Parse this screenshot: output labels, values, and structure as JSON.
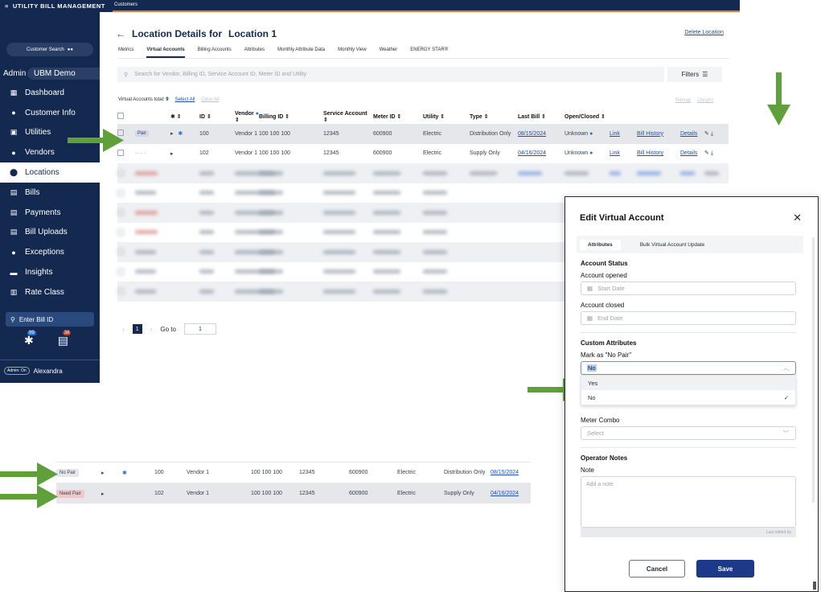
{
  "app": {
    "brand": "UTILITY BILL MANAGEMENT",
    "crumb": "Customers"
  },
  "sidebar": {
    "customer_search": "Customer Search",
    "role": "Admin",
    "org": "UBM Demo",
    "items": [
      {
        "label": "Dashboard",
        "icon": "dashboard-icon"
      },
      {
        "label": "Customer Info",
        "icon": "person-icon"
      },
      {
        "label": "Utilities",
        "icon": "utilities-icon"
      },
      {
        "label": "Vendors",
        "icon": "person-icon"
      },
      {
        "label": "Locations",
        "icon": "location-pin-icon"
      },
      {
        "label": "Bills",
        "icon": "bills-icon"
      },
      {
        "label": "Payments",
        "icon": "payments-icon"
      },
      {
        "label": "Bill Uploads",
        "icon": "upload-icon"
      },
      {
        "label": "Exceptions",
        "icon": "exclamation-icon"
      },
      {
        "label": "Insights",
        "icon": "insights-icon"
      },
      {
        "label": "Rate Class",
        "icon": "chart-icon"
      }
    ],
    "bill_id_placeholder": "Enter Bill ID",
    "badge_a": "99",
    "badge_b": "38",
    "admin_on": "Admin: On",
    "user": "Alexandra"
  },
  "page": {
    "title_prefix": "Location Details for",
    "title_location": "Location 1",
    "delete": "Delete Location",
    "tabs": [
      "Metrics",
      "Virtual Accounts",
      "Billing Accounts",
      "Attributes",
      "Monthly Attribute Data",
      "Monthly View",
      "Weather",
      "ENERGY STAR®"
    ],
    "search_placeholder": "Search for Vendor, Billing ID, Service Account ID, Meter ID and Utility",
    "filters": "Filters",
    "totals_label": "Virtual Accounts total:",
    "totals_value": "9",
    "select_all": "Select All",
    "clear_all": "Clear All",
    "remap": "Remap",
    "unsync": "Unsync",
    "goto": "Go to",
    "goto_value": "1",
    "page_current": "1"
  },
  "table": {
    "headers": [
      "",
      "",
      "✱ ⇕",
      "ID ⇕",
      "Vendor",
      "Billing ID ⇕",
      "Service Account ⇕",
      "Meter ID ⇕",
      "Utility ⇕",
      "Type ⇕",
      "Last Bill ⇕",
      "Open/Closed ⇕"
    ],
    "rows": [
      {
        "tag": "Pair",
        "star": "✱",
        "id": "100",
        "vendor": "Vendor 1",
        "billing": "100 100 100",
        "service": "12345",
        "meter": "600900",
        "utility": "Electric",
        "type": "Distribution Only",
        "last_bill": "08/15/2024",
        "status": "Unknown",
        "link": "Link",
        "history": "Bill History",
        "details": "Details"
      },
      {
        "tag": "",
        "star": "",
        "id": "102",
        "vendor": "Vendor 1",
        "billing": "100 100 100",
        "service": "12345",
        "meter": "600900",
        "utility": "Electric",
        "type": "Supply Only",
        "last_bill": "04/16/2024",
        "status": "Unknown",
        "link": "Link",
        "history": "Bill History",
        "details": "Details"
      }
    ]
  },
  "strip": {
    "rows": [
      {
        "tag": "No Pair",
        "star": "✱",
        "id": "100",
        "vendor": "Vendor 1",
        "billing": "100 100 100",
        "service": "12345",
        "meter": "600900",
        "utility": "Electric",
        "type": "Distribution Only",
        "last_bill": "08/15/2024"
      },
      {
        "tag": "Need Pair",
        "star": "",
        "id": "102",
        "vendor": "Vendor 1",
        "billing": "100 100 100",
        "service": "12345",
        "meter": "600900",
        "utility": "Electric",
        "type": "Supply Only",
        "last_bill": "04/16/2024"
      }
    ]
  },
  "modal": {
    "title": "Edit Virtual Account",
    "tabs": [
      "Attributes",
      "Bulk Virtual Account Update"
    ],
    "account_status": "Account Status",
    "opened_label": "Account opened",
    "opened_placeholder": "Start Date",
    "closed_label": "Account closed",
    "closed_placeholder": "End Date",
    "custom_attrs": "Custom Attributes",
    "no_pair_label": "Mark as \"No Pair\"",
    "no_pair_value": "No",
    "options": [
      "Yes",
      "No"
    ],
    "meter_combo_label": "Meter Combo",
    "meter_combo_placeholder": "Select",
    "operator_notes": "Operator Notes",
    "note_label": "Note",
    "note_placeholder": "Add a note",
    "last_edited": "Last edited by",
    "cancel": "Cancel",
    "save": "Save"
  },
  "colors": {
    "navy": "#14294f",
    "arrow": "#5fa03a",
    "accent": "#e8782a",
    "link": "#1e4fb3"
  }
}
